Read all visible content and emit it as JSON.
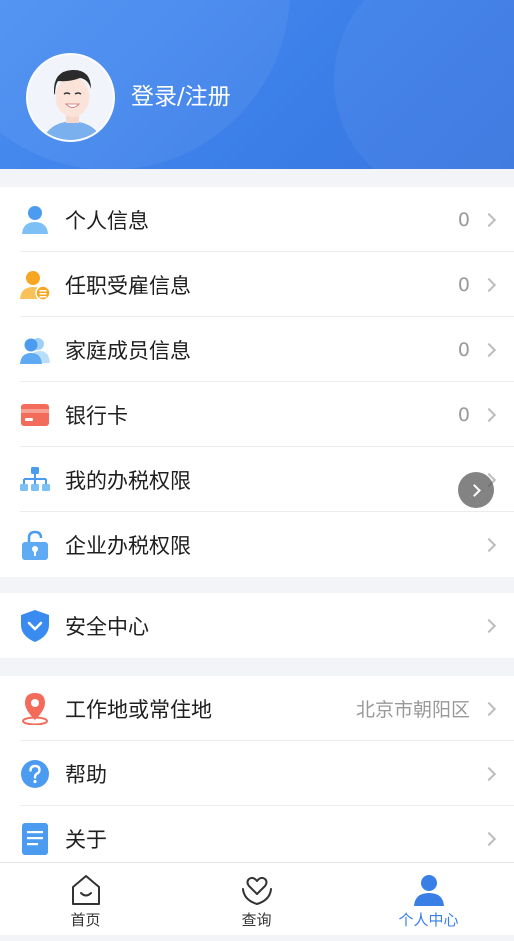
{
  "header": {
    "login_label": "登录/注册"
  },
  "group1": [
    {
      "label": "个人信息",
      "value": "0",
      "icon": "person-icon"
    },
    {
      "label": "任职受雇信息",
      "value": "0",
      "icon": "employment-icon"
    },
    {
      "label": "家庭成员信息",
      "value": "0",
      "icon": "family-icon"
    },
    {
      "label": "银行卡",
      "value": "0",
      "icon": "bank-card-icon"
    },
    {
      "label": "我的办税权限",
      "value": "",
      "icon": "org-chart-icon"
    },
    {
      "label": "企业办税权限",
      "value": "",
      "icon": "lock-icon"
    }
  ],
  "group2": [
    {
      "label": "安全中心",
      "value": "",
      "icon": "shield-icon"
    }
  ],
  "group3": [
    {
      "label": "工作地或常住地",
      "value": "北京市朝阳区",
      "icon": "location-pin-icon"
    },
    {
      "label": "帮助",
      "value": "",
      "icon": "help-icon"
    },
    {
      "label": "关于",
      "value": "",
      "icon": "document-icon"
    }
  ],
  "tabs": [
    {
      "label": "首页",
      "icon": "home-icon",
      "active": false
    },
    {
      "label": "查询",
      "icon": "heart-hands-icon",
      "active": false
    },
    {
      "label": "个人中心",
      "icon": "profile-icon",
      "active": true
    }
  ],
  "colors": {
    "accent": "#3a7fe6",
    "header": "#4a8ff2"
  }
}
